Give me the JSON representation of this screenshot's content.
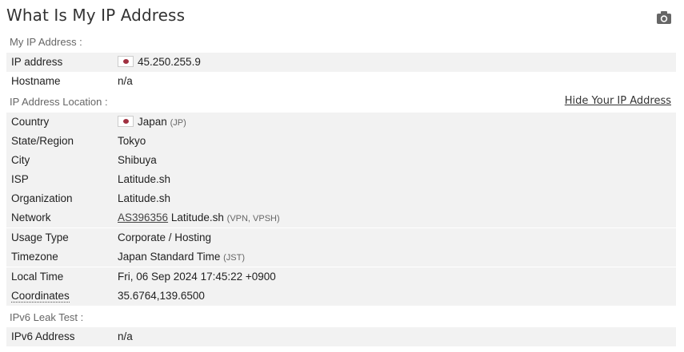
{
  "page": {
    "title": "What Is My IP Address",
    "camera_icon": "camera-icon"
  },
  "sections": {
    "my_ip": "My IP Address :",
    "location": "IP Address Location :",
    "ipv6": "IPv6 Leak Test :"
  },
  "hide_link": "Hide Your IP Address",
  "my_ip": {
    "ip_label": "IP address",
    "ip_value": "45.250.255.9",
    "hostname_label": "Hostname",
    "hostname_value": "n/a"
  },
  "location": {
    "country_label": "Country",
    "country_value": "Japan",
    "country_code": "(JP)",
    "region_label": "State/Region",
    "region_value": "Tokyo",
    "city_label": "City",
    "city_value": "Shibuya",
    "isp_label": "ISP",
    "isp_value": "Latitude.sh",
    "org_label": "Organization",
    "org_value": "Latitude.sh",
    "network_label": "Network",
    "network_asn": "AS396356",
    "network_name": "Latitude.sh",
    "network_tags": "(VPN, VPSH)",
    "usage_label": "Usage Type",
    "usage_value": "Corporate / Hosting",
    "timezone_label": "Timezone",
    "timezone_value": "Japan Standard Time",
    "timezone_abbr": "(JST)",
    "localtime_label": "Local Time",
    "localtime_value": "Fri, 06 Sep 2024 17:45:22 +0900",
    "coords_label": "Coordinates",
    "coords_value": "35.6764,139.6500"
  },
  "ipv6": {
    "label": "IPv6 Address",
    "value": "n/a"
  },
  "colors": {
    "row_shade": "#f2f2f2",
    "flag_red": "#a03040"
  }
}
